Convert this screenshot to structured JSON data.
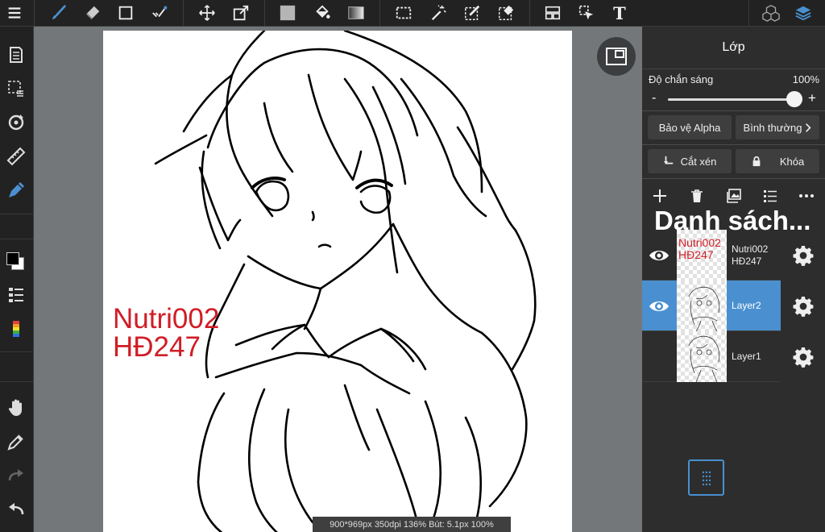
{
  "toolbar": {
    "icons": [
      "menu-icon",
      "brush-icon",
      "eraser-icon",
      "shape-icon",
      "smudge-icon",
      "move-icon",
      "transform-icon",
      "fill-color-icon",
      "bucket-icon",
      "gradient-icon",
      "select-rect-icon",
      "magic-wand-icon",
      "select-pen-icon",
      "select-eraser-icon",
      "frame-icon",
      "pointer-icon",
      "text-icon",
      "3d-icon",
      "layers-icon"
    ],
    "text_tool_label": "T"
  },
  "colors": {
    "accent": "#4a90d0",
    "watermark": "#d01d26",
    "primary": "#000000",
    "secondary": "#ffffff"
  },
  "canvas": {
    "watermark_line1": "Nutri002",
    "watermark_line2": "HĐ247",
    "status": "900*969px 350dpi 136% Bút: 5.1px 100%"
  },
  "layers_panel": {
    "title": "Lớp",
    "opacity_label": "Độ chắn sáng",
    "opacity_value": "100%",
    "opacity_level": 1.0,
    "minus": "-",
    "plus": "+",
    "alpha_protect": "Bảo vệ Alpha",
    "blend_mode": "Bình thường",
    "clip": "Cắt xén",
    "lock": "Khóa",
    "list_title": "Danh sách...",
    "layers": [
      {
        "name_line1": "Nutri002",
        "name_line2": "HĐ247",
        "thumb_line1": "Nutri002",
        "thumb_line2": "HĐ247",
        "visible": true,
        "selected": false
      },
      {
        "name": "Layer2",
        "visible": true,
        "selected": true
      },
      {
        "name": "Layer1",
        "visible": false,
        "selected": false
      }
    ]
  }
}
